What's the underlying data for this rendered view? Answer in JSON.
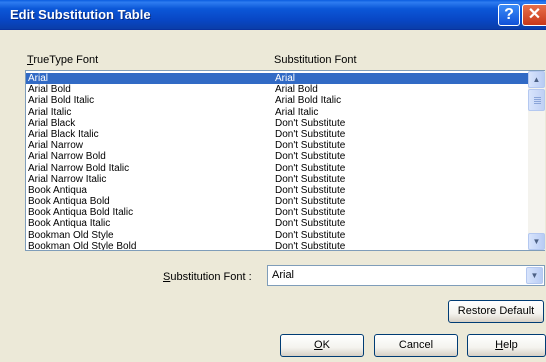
{
  "window": {
    "title": "Edit Substitution Table",
    "help_glyph": "?",
    "close_glyph": "✕"
  },
  "headers": {
    "truetype_prefix": "T",
    "truetype_rest": "rueType Font",
    "substitution": "Substitution Font"
  },
  "rows": [
    {
      "font": "Arial",
      "sub": "Arial",
      "selected": true
    },
    {
      "font": "Arial Bold",
      "sub": "Arial Bold"
    },
    {
      "font": "Arial Bold Italic",
      "sub": "Arial Bold Italic"
    },
    {
      "font": "Arial Italic",
      "sub": "Arial Italic"
    },
    {
      "font": "Arial Black",
      "sub": "Don't Substitute"
    },
    {
      "font": "Arial Black Italic",
      "sub": "Don't Substitute"
    },
    {
      "font": "Arial Narrow",
      "sub": "Don't Substitute"
    },
    {
      "font": "Arial Narrow Bold",
      "sub": "Don't Substitute"
    },
    {
      "font": "Arial Narrow Bold Italic",
      "sub": "Don't Substitute"
    },
    {
      "font": "Arial Narrow Italic",
      "sub": "Don't Substitute"
    },
    {
      "font": "Book Antiqua",
      "sub": "Don't Substitute"
    },
    {
      "font": "Book Antiqua Bold",
      "sub": "Don't Substitute"
    },
    {
      "font": "Book Antiqua Bold Italic",
      "sub": "Don't Substitute"
    },
    {
      "font": "Book Antiqua Italic",
      "sub": "Don't Substitute"
    },
    {
      "font": "Bookman Old Style",
      "sub": "Don't Substitute"
    },
    {
      "font": "Bookman Old Style Bold",
      "sub": "Don't Substitute"
    }
  ],
  "substitution_field": {
    "label_prefix": "S",
    "label_rest": "ubstitution Font :",
    "value": "Arial"
  },
  "buttons": {
    "restore": "Restore Default",
    "ok_prefix": "O",
    "ok_rest": "K",
    "cancel": "Cancel",
    "help_prefix": "H",
    "help_rest": "elp"
  },
  "icons": {
    "scroll_up": "up-arrow-icon",
    "scroll_down": "down-arrow-icon",
    "dropdown": "chevron-down-icon"
  },
  "colors": {
    "titlebar": "#0b57d8",
    "selection": "#316ac5",
    "dialog_bg": "#ece9d8"
  }
}
